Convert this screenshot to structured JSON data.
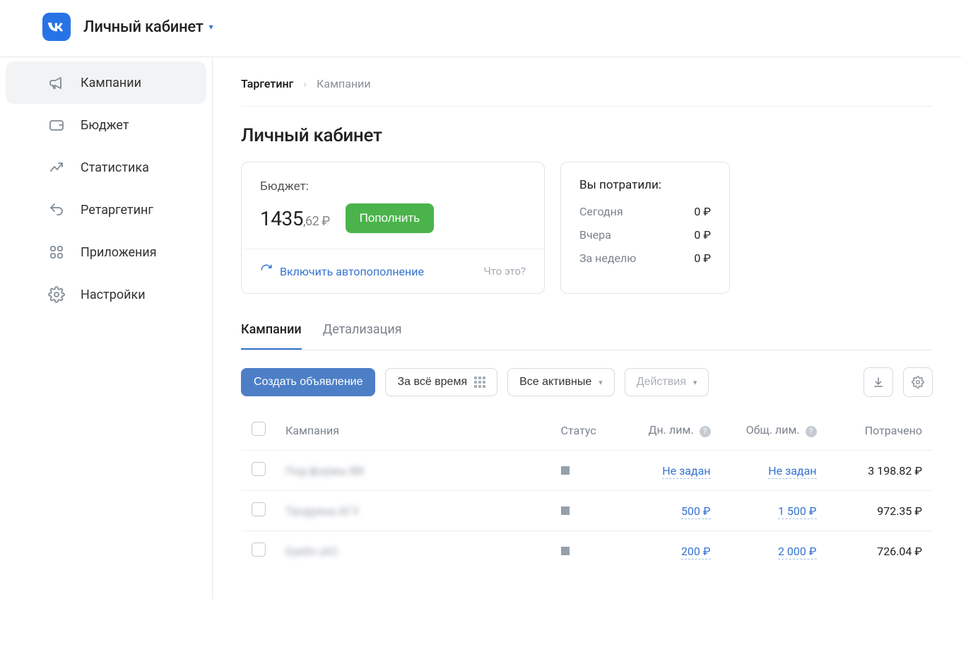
{
  "header": {
    "title": "Личный кабинет"
  },
  "sidebar": {
    "items": [
      {
        "label": "Кампании"
      },
      {
        "label": "Бюджет"
      },
      {
        "label": "Статистика"
      },
      {
        "label": "Ретаргетинг"
      },
      {
        "label": "Приложения"
      },
      {
        "label": "Настройки"
      }
    ]
  },
  "breadcrumb": {
    "root": "Таргетинг",
    "leaf": "Кампании"
  },
  "page": {
    "title": "Личный кабинет"
  },
  "budget": {
    "label": "Бюджет:",
    "amount_int": "1435",
    "amount_cents": ",62 ₽",
    "topup": "Пополнить",
    "auto": "Включить автопополнение",
    "what": "Что это?"
  },
  "spent": {
    "title": "Вы потратили:",
    "rows": [
      {
        "key": "Сегодня",
        "val": "0 ₽"
      },
      {
        "key": "Вчера",
        "val": "0 ₽"
      },
      {
        "key": "За неделю",
        "val": "0 ₽"
      }
    ]
  },
  "tabs": [
    {
      "label": "Кампании"
    },
    {
      "label": "Детализация"
    }
  ],
  "toolbar": {
    "create": "Создать объявление",
    "range": "За всё время",
    "filter": "Все активные",
    "actions": "Действия"
  },
  "table": {
    "headers": {
      "campaign": "Кампания",
      "status": "Статус",
      "daily": "Дн. лим.",
      "total": "Общ. лим.",
      "spent": "Потрачено"
    },
    "rows": [
      {
        "name": "Под формы ВК",
        "daily": "Не задан",
        "total": "Не задан",
        "spent": "3 198.82 ₽"
      },
      {
        "name": "Тандуина АГУ",
        "daily": "500 ₽",
        "total": "1 500 ₽",
        "spent": "972.35 ₽"
      },
      {
        "name": "Dyelin uh2",
        "daily": "200 ₽",
        "total": "2 000 ₽",
        "spent": "726.04 ₽"
      }
    ]
  }
}
